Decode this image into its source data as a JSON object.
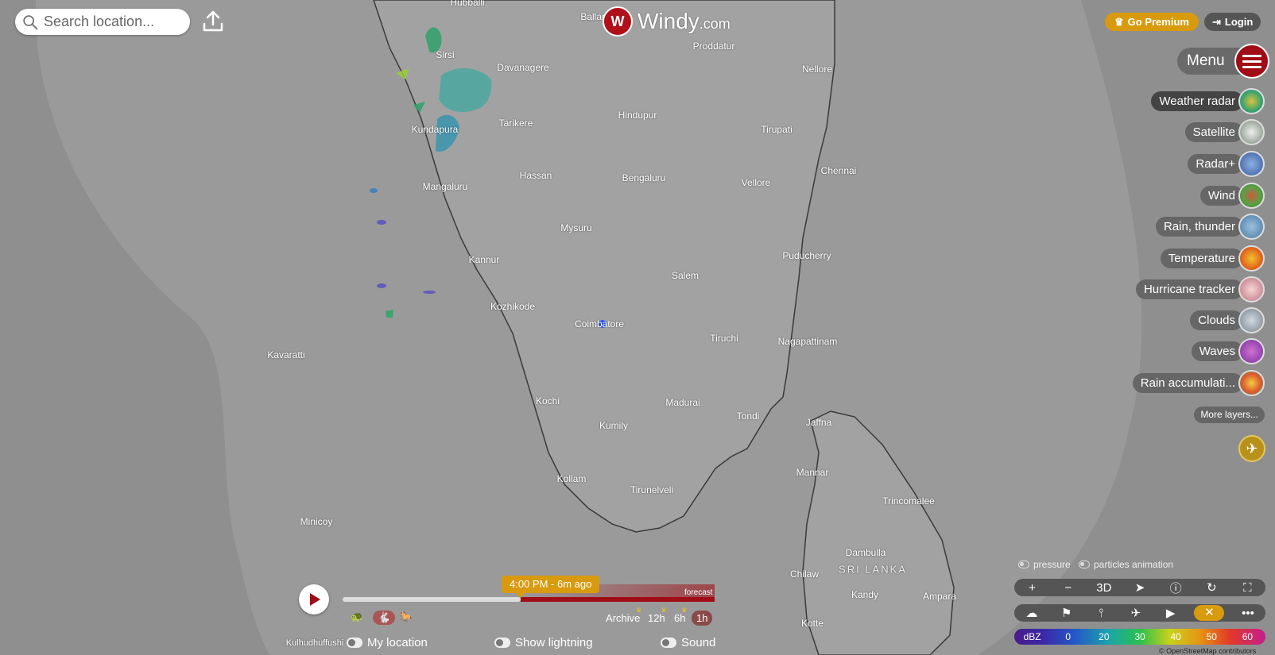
{
  "search": {
    "placeholder": "Search location..."
  },
  "logo": {
    "name": "Windy",
    "suffix": ".com",
    "badge": "W"
  },
  "header": {
    "premium_label": "Go Premium",
    "login_label": "Login"
  },
  "menu": {
    "label": "Menu"
  },
  "layers": [
    {
      "label": "Weather radar",
      "active": true,
      "color": "#3aa56b"
    },
    {
      "label": "Satellite",
      "active": false,
      "color": "#c8d0c8"
    },
    {
      "label": "Radar+",
      "active": false,
      "color": "#4a6fb5"
    },
    {
      "label": "Wind",
      "active": false,
      "color": "#5aa046"
    },
    {
      "label": "Rain, thunder",
      "active": false,
      "color": "#5a8fb0"
    },
    {
      "label": "Temperature",
      "active": false,
      "color": "#e26a1c"
    },
    {
      "label": "Hurricane tracker",
      "active": false,
      "color": "#d98a9a"
    },
    {
      "label": "Clouds",
      "active": false,
      "color": "#9aa5b0"
    },
    {
      "label": "Waves",
      "active": false,
      "color": "#9a3fb5"
    },
    {
      "label": "Rain accumulati...",
      "active": false,
      "color": "#d9472a"
    }
  ],
  "more_layers_label": "More layers...",
  "map_toggles": {
    "pressure": "pressure",
    "particles": "particles animation"
  },
  "toolbar_top": {
    "zoom_in": "+",
    "zoom_out": "−",
    "three_d": "3D"
  },
  "timeline": {
    "current_time": "4:00 PM - 6m ago",
    "forecast_label": "forecast",
    "archive_label": "Archive",
    "ranges": [
      "12h",
      "6h",
      "1h"
    ],
    "active_range": "1h"
  },
  "bottom": {
    "my_location": "My location",
    "show_lightning": "Show lightning",
    "sound": "Sound"
  },
  "scale": {
    "unit": "dBZ",
    "ticks": [
      "0",
      "20",
      "30",
      "40",
      "50",
      "60"
    ]
  },
  "attribution": "© OpenStreetMap contributors",
  "map": {
    "cities": [
      {
        "name": "Hubballi"
      },
      {
        "name": "Ballari"
      },
      {
        "name": "Proddatur"
      },
      {
        "name": "Sirsi"
      },
      {
        "name": "Davanagere"
      },
      {
        "name": "Nellore"
      },
      {
        "name": "Hindupur"
      },
      {
        "name": "Kundapura"
      },
      {
        "name": "Tarikere"
      },
      {
        "name": "Tirupati"
      },
      {
        "name": "Hassan"
      },
      {
        "name": "Chennai"
      },
      {
        "name": "Mangaluru"
      },
      {
        "name": "Bengaluru"
      },
      {
        "name": "Vellore"
      },
      {
        "name": "Mysuru"
      },
      {
        "name": "Kannur"
      },
      {
        "name": "Puducherry"
      },
      {
        "name": "Salem"
      },
      {
        "name": "Kozhikode"
      },
      {
        "name": "Coimbatore"
      },
      {
        "name": "Tiruchi"
      },
      {
        "name": "Nagapattinam"
      },
      {
        "name": "Kavaratti"
      },
      {
        "name": "Kochi"
      },
      {
        "name": "Madurai"
      },
      {
        "name": "Tondi"
      },
      {
        "name": "Jaffna"
      },
      {
        "name": "Kumily"
      },
      {
        "name": "Kollam"
      },
      {
        "name": "Tirunelveli"
      },
      {
        "name": "Mannar"
      },
      {
        "name": "Trincomalee"
      },
      {
        "name": "Minicoy"
      },
      {
        "name": "Dambulla"
      },
      {
        "name": "Chilaw"
      },
      {
        "name": "Kandy"
      },
      {
        "name": "Ampara"
      },
      {
        "name": "Kotte"
      },
      {
        "name": "Kulhudhuffushi"
      }
    ],
    "country": "SRI LANKA"
  }
}
